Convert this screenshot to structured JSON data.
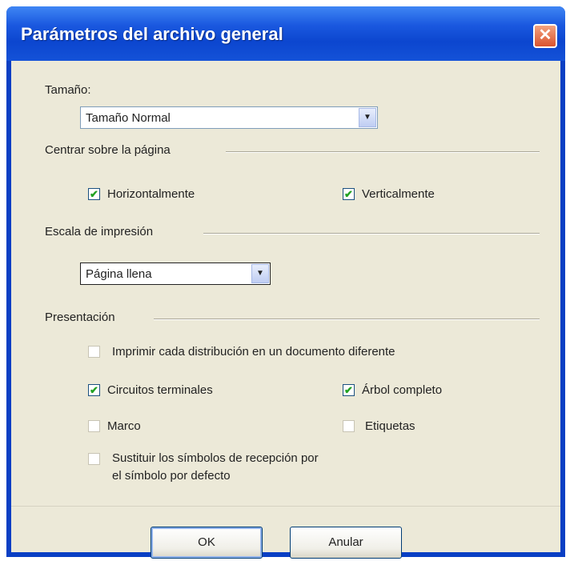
{
  "window": {
    "title": "Parámetros del archivo general",
    "close_glyph": "✕"
  },
  "sections": {
    "size": {
      "label": "Tamaño:",
      "selected": "Tamaño Normal"
    },
    "center": {
      "label": "Centrar sobre la página",
      "horizontal": {
        "label": "Horizontalmente",
        "checked": true
      },
      "vertical": {
        "label": "Verticalmente",
        "checked": true
      }
    },
    "scale": {
      "label": "Escala de impresión",
      "selected": "Página llena"
    },
    "presentation": {
      "label": "Presentación",
      "print_each": {
        "label": "Imprimir cada distribución en un documento diferente",
        "checked": false
      },
      "circuits": {
        "label": "Circuitos terminales",
        "checked": true
      },
      "full_tree": {
        "label": "Árbol completo",
        "checked": true
      },
      "frame": {
        "label": "Marco",
        "checked": false
      },
      "labels": {
        "label": "Etiquetas",
        "checked": false
      },
      "replace_symbols": {
        "label": "Sustituir los símbolos de recepción por el símbolo por defecto",
        "line1": "Sustituir los símbolos de recepción por",
        "line2": "el símbolo por defecto",
        "checked": false
      }
    }
  },
  "buttons": {
    "ok": "OK",
    "cancel": "Anular"
  },
  "glyphs": {
    "check": "✔",
    "dropdown": "▼"
  }
}
